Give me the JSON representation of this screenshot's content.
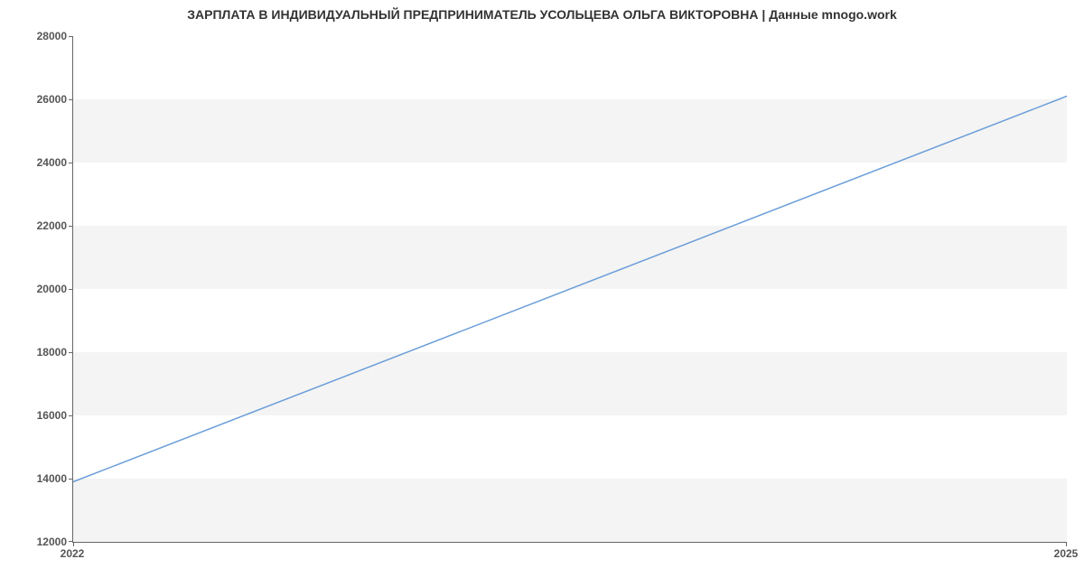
{
  "chart_data": {
    "type": "line",
    "title": "ЗАРПЛАТА В ИНДИВИДУАЛЬНЫЙ ПРЕДПРИНИМАТЕЛЬ УСОЛЬЦЕВА ОЛЬГА ВИКТОРОВНА | Данные mnogo.work",
    "x": [
      2022,
      2025
    ],
    "values": [
      13900,
      26100
    ],
    "xlabel": "",
    "ylabel": "",
    "ylim": [
      12000,
      28000
    ],
    "y_ticks": [
      12000,
      14000,
      16000,
      18000,
      20000,
      22000,
      24000,
      26000,
      28000
    ],
    "x_ticks": [
      2022,
      2025
    ],
    "line_color": "#6a9ed8",
    "band_color": "#f4f4f4"
  }
}
